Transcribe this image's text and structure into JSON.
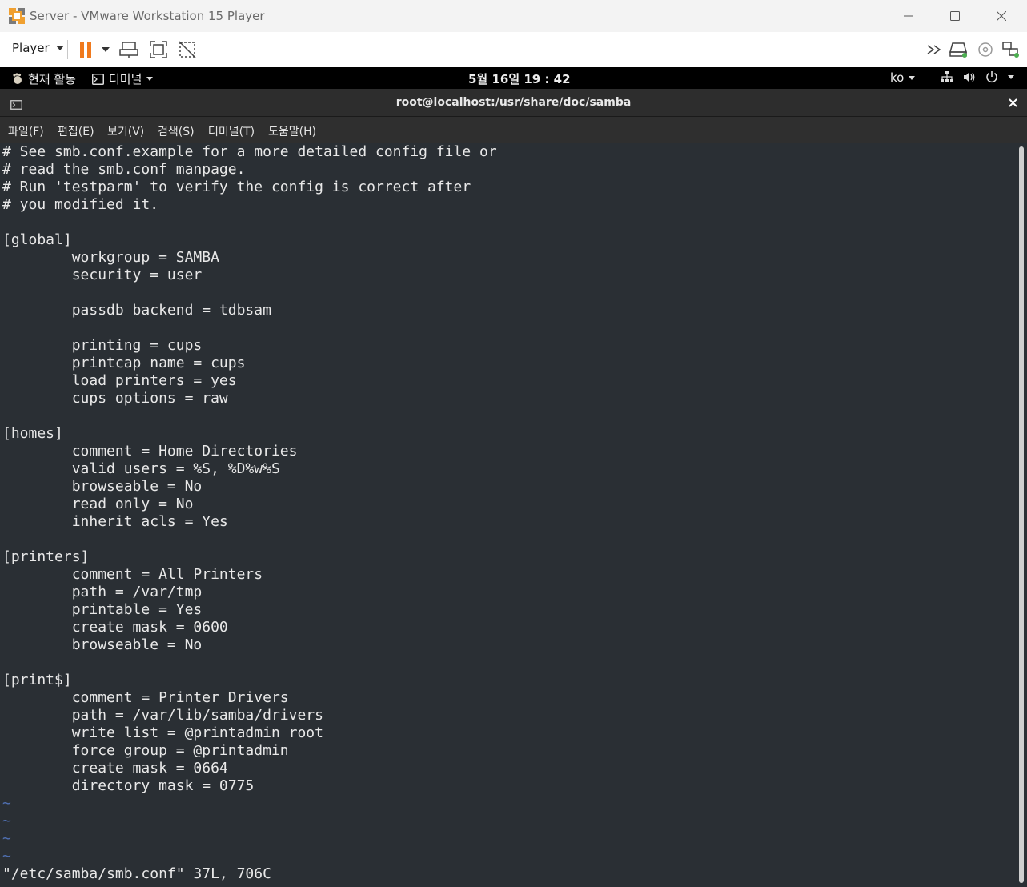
{
  "window": {
    "title": "Server - VMware Workstation 15 Player"
  },
  "toolbar": {
    "player_label": "Player"
  },
  "gnome_bar": {
    "activities": "현재 활동",
    "app_menu": "터미널",
    "clock": "5월 16일  19 : 42",
    "input_method": "ko"
  },
  "terminal": {
    "title": "root@localhost:/usr/share/doc/samba",
    "menu": [
      "파일(F)",
      "편집(E)",
      "보기(V)",
      "검색(S)",
      "터미널(T)",
      "도움말(H)"
    ],
    "lines": [
      "# See smb.conf.example for a more detailed config file or",
      "# read the smb.conf manpage.",
      "# Run 'testparm' to verify the config is correct after",
      "# you modified it.",
      "",
      "[global]",
      "        workgroup = SAMBA",
      "        security = user",
      "",
      "        passdb backend = tdbsam",
      "",
      "        printing = cups",
      "        printcap name = cups",
      "        load printers = yes",
      "        cups options = raw",
      "",
      "[homes]",
      "        comment = Home Directories",
      "        valid users = %S, %D%w%S",
      "        browseable = No",
      "        read only = No",
      "        inherit acls = Yes",
      "",
      "[printers]",
      "        comment = All Printers",
      "        path = /var/tmp",
      "        printable = Yes",
      "        create mask = 0600",
      "        browseable = No",
      "",
      "[print$]",
      "        comment = Printer Drivers",
      "        path = /var/lib/samba/drivers",
      "        write list = @printadmin root",
      "        force group = @printadmin",
      "        create mask = 0664",
      "        directory mask = 0775",
      "~",
      "~",
      "~",
      "~"
    ],
    "status_line": "\"/etc/samba/smb.conf\" 37L, 706C"
  },
  "colors": {
    "terminal_bg": "#2a2f34",
    "terminal_fg": "#e8e8e8",
    "tilde": "#4f6fb0",
    "pause_orange": "#f07a1e"
  }
}
